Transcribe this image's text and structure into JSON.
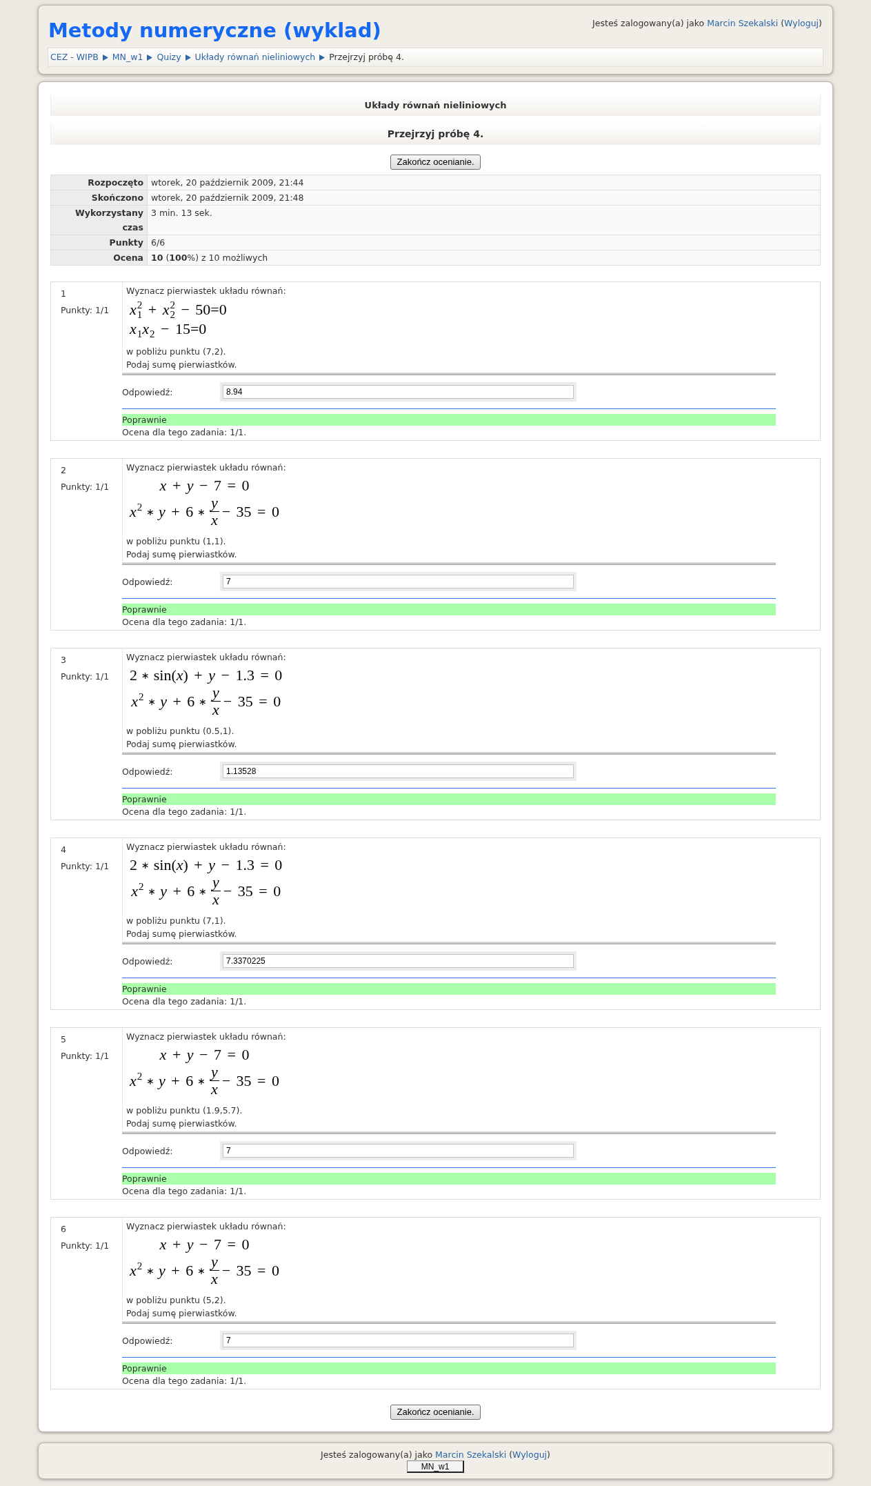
{
  "header": {
    "title": "Metody numeryczne (wyklad)",
    "login": [
      {
        "kind": "text",
        "text": "Jesteś zalogowany(a) jako "
      },
      {
        "kind": "user",
        "text": "Marcin Szekalski"
      },
      {
        "kind": "text",
        "text": " ("
      },
      {
        "kind": "logout",
        "text": "Wyloguj"
      },
      {
        "kind": "text",
        "text": ")"
      }
    ],
    "breadcrumb": [
      {
        "label": "CEZ - WIPB",
        "current": false
      },
      {
        "label": "MN_w1",
        "current": false
      },
      {
        "label": "Quizy",
        "current": false
      },
      {
        "label": "Układy równań nieliniowych",
        "current": false
      },
      {
        "label": "Przejrzyj próbę 4.",
        "current": true
      }
    ]
  },
  "quiz_title": "Układy równań nieliniowych",
  "attempt_title": "Przejrzyj próbę 4.",
  "finish_button_top": "Zakończ ocenianie.",
  "summary": [
    {
      "label": "Rozpoczęto",
      "value": "wtorek, 20 październik 2009, 21:44"
    },
    {
      "label": "Skończono",
      "value": "wtorek, 20 październik 2009, 21:48"
    },
    {
      "label": "Wykorzystany czas",
      "value": "3 min. 13 sek."
    },
    {
      "label": "Punkty",
      "value": "6/6"
    },
    {
      "label": "Ocena",
      "value": "**10** (**100**%) z 10 możliwych"
    }
  ],
  "questions": [
    {
      "number": "1",
      "points": "Punkty: 1/1",
      "prompt": "Wyznacz pierwiastek układu równań:",
      "equations": {
        "centered": false,
        "lines": [
          [
            {
              "kind": "script",
              "base": "x",
              "sub": "1",
              "sup": "2"
            },
            {
              "kind": "text",
              "text": " + "
            },
            {
              "kind": "script",
              "base": "x",
              "sub": "2",
              "sup": "2"
            },
            {
              "kind": "text",
              "text": " − 50=0"
            }
          ],
          [
            {
              "kind": "script",
              "base": "x",
              "sub": "1"
            },
            {
              "kind": "script",
              "base": "x",
              "sub": "2"
            },
            {
              "kind": "text",
              "text": " − 15=0"
            }
          ]
        ]
      },
      "hints": [
        "w pobliżu punktu (7,2).",
        "Podaj sumę pierwiastków."
      ],
      "answer_label": "Odpowiedź:",
      "answer": "8.94",
      "correct": true,
      "feedback": "Poprawnie",
      "grade": "Ocena dla tego zadania: 1/1."
    },
    {
      "number": "2",
      "points": "Punkty: 1/1",
      "prompt": "Wyznacz pierwiastek układu równań:",
      "equations": {
        "centered": true,
        "lines": [
          [
            {
              "kind": "text",
              "text": "*x* + *y* − 7 = 0"
            }
          ],
          [
            {
              "kind": "script",
              "base": "x",
              "sup": "2"
            },
            {
              "kind": "op",
              "text": "∗"
            },
            {
              "kind": "text",
              "text": "*y* + 6"
            },
            {
              "kind": "op",
              "text": "∗"
            },
            {
              "kind": "frac",
              "num": "y",
              "den": "x"
            },
            {
              "kind": "text",
              "text": "− 35 = 0"
            }
          ]
        ]
      },
      "hints": [
        "w pobliżu punktu (1,1).",
        "Podaj sumę pierwiastków."
      ],
      "answer_label": "Odpowiedź:",
      "answer": "7",
      "correct": true,
      "feedback": "Poprawnie",
      "grade": "Ocena dla tego zadania: 1/1."
    },
    {
      "number": "3",
      "points": "Punkty: 1/1",
      "prompt": "Wyznacz pierwiastek układu równań:",
      "equations": {
        "centered": true,
        "lines": [
          [
            {
              "kind": "text",
              "text": "2"
            },
            {
              "kind": "op",
              "text": "∗"
            },
            {
              "kind": "text",
              "text": "sin(*x*) + *y* − 1.3 = 0"
            }
          ],
          [
            {
              "kind": "script",
              "base": "x",
              "sup": "2"
            },
            {
              "kind": "op",
              "text": "∗"
            },
            {
              "kind": "text",
              "text": "*y* + 6"
            },
            {
              "kind": "op",
              "text": "∗"
            },
            {
              "kind": "frac",
              "num": "y",
              "den": "x"
            },
            {
              "kind": "text",
              "text": "− 35 = 0"
            }
          ]
        ]
      },
      "hints": [
        "w pobliżu punktu (0.5,1).",
        "Podaj sumę pierwiastków."
      ],
      "answer_label": "Odpowiedź:",
      "answer": "1.13528",
      "correct": true,
      "feedback": "Poprawnie",
      "grade": "Ocena dla tego zadania: 1/1."
    },
    {
      "number": "4",
      "points": "Punkty: 1/1",
      "prompt": "Wyznacz pierwiastek układu równań:",
      "equations": {
        "centered": true,
        "lines": [
          [
            {
              "kind": "text",
              "text": "2"
            },
            {
              "kind": "op",
              "text": "∗"
            },
            {
              "kind": "text",
              "text": "sin(*x*) + *y* − 1.3 = 0"
            }
          ],
          [
            {
              "kind": "script",
              "base": "x",
              "sup": "2"
            },
            {
              "kind": "op",
              "text": "∗"
            },
            {
              "kind": "text",
              "text": "*y* + 6"
            },
            {
              "kind": "op",
              "text": "∗"
            },
            {
              "kind": "frac",
              "num": "y",
              "den": "x"
            },
            {
              "kind": "text",
              "text": "− 35 = 0"
            }
          ]
        ]
      },
      "hints": [
        "w pobliżu punktu (7,1).",
        "Podaj sumę pierwiastków."
      ],
      "answer_label": "Odpowiedź:",
      "answer": "7.3370225",
      "correct": true,
      "feedback": "Poprawnie",
      "grade": "Ocena dla tego zadania: 1/1."
    },
    {
      "number": "5",
      "points": "Punkty: 1/1",
      "prompt": "Wyznacz pierwiastek układu równań:",
      "equations": {
        "centered": true,
        "lines": [
          [
            {
              "kind": "text",
              "text": "*x* + *y* − 7 = 0"
            }
          ],
          [
            {
              "kind": "script",
              "base": "x",
              "sup": "2"
            },
            {
              "kind": "op",
              "text": "∗"
            },
            {
              "kind": "text",
              "text": "*y* + 6"
            },
            {
              "kind": "op",
              "text": "∗"
            },
            {
              "kind": "frac",
              "num": "y",
              "den": "x"
            },
            {
              "kind": "text",
              "text": "− 35 = 0"
            }
          ]
        ]
      },
      "hints": [
        "w pobliżu punktu (1.9,5.7).",
        "Podaj sumę pierwiastków."
      ],
      "answer_label": "Odpowiedź:",
      "answer": "7",
      "correct": true,
      "feedback": "Poprawnie",
      "grade": "Ocena dla tego zadania: 1/1."
    },
    {
      "number": "6",
      "points": "Punkty: 1/1",
      "prompt": "Wyznacz pierwiastek układu równań:",
      "equations": {
        "centered": true,
        "lines": [
          [
            {
              "kind": "text",
              "text": "*x* + *y* − 7 = 0"
            }
          ],
          [
            {
              "kind": "script",
              "base": "x",
              "sup": "2"
            },
            {
              "kind": "op",
              "text": "∗"
            },
            {
              "kind": "text",
              "text": "*y* + 6"
            },
            {
              "kind": "op",
              "text": "∗"
            },
            {
              "kind": "frac",
              "num": "y",
              "den": "x"
            },
            {
              "kind": "text",
              "text": "− 35 = 0"
            }
          ]
        ]
      },
      "hints": [
        "w pobliżu punktu (5,2).",
        "Podaj sumę pierwiastków."
      ],
      "answer_label": "Odpowiedź:",
      "answer": "7",
      "correct": true,
      "feedback": "Poprawnie",
      "grade": "Ocena dla tego zadania: 1/1."
    }
  ],
  "finish_button_bottom": "Zakończ ocenianie.",
  "footer": {
    "login": [
      {
        "kind": "text",
        "text": "Jesteś zalogowany(a) jako "
      },
      {
        "kind": "user",
        "text": "Marcin Szekalski"
      },
      {
        "kind": "text",
        "text": " ("
      },
      {
        "kind": "logout",
        "text": "Wyloguj"
      },
      {
        "kind": "text",
        "text": ")"
      }
    ],
    "course_button": "MN_w1"
  }
}
